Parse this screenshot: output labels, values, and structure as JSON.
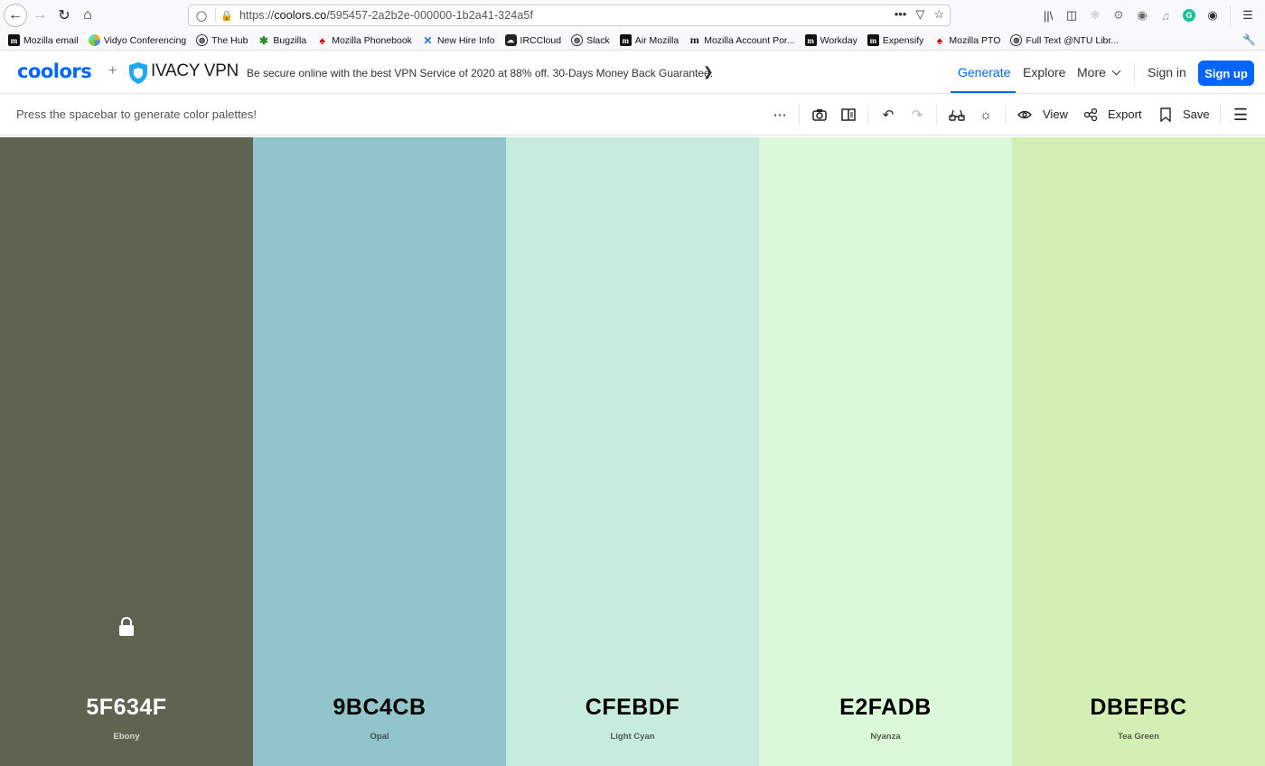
{
  "browser": {
    "url_prefix": "https://",
    "url_domain": "coolors.co",
    "url_path": "/595457-2a2b2e-000000-1b2a41-324a5f",
    "url_actions": [
      "•••",
      "pocket",
      "star"
    ],
    "bookmarks": [
      {
        "label": "Mozilla email",
        "icon": "m",
        "icon_type": "m"
      },
      {
        "label": "Vidyo Conferencing",
        "icon": "",
        "icon_type": "vidyo"
      },
      {
        "label": "The Hub",
        "icon": "◍",
        "icon_type": "globe"
      },
      {
        "label": "Bugzilla",
        "icon": "✱",
        "icon_type": "green"
      },
      {
        "label": "Mozilla Phonebook",
        "icon": "♠",
        "icon_type": "red"
      },
      {
        "label": "New Hire Info",
        "icon": "✕",
        "icon_type": "blue"
      },
      {
        "label": "IRCCloud",
        "icon": "☁",
        "icon_type": "irc"
      },
      {
        "label": "Slack",
        "icon": "◍",
        "icon_type": "globe"
      },
      {
        "label": "Air Mozilla",
        "icon": "m",
        "icon_type": "m"
      },
      {
        "label": "Mozilla Account Por...",
        "icon": "m",
        "icon_type": "mm"
      },
      {
        "label": "Workday",
        "icon": "m",
        "icon_type": "m"
      },
      {
        "label": "Expensify",
        "icon": "m",
        "icon_type": "m"
      },
      {
        "label": "Mozilla PTO",
        "icon": "♠",
        "icon_type": "red"
      },
      {
        "label": "Full Text @NTU Libr...",
        "icon": "◍",
        "icon_type": "globe"
      }
    ]
  },
  "header": {
    "logo": "coolors",
    "plus": "+",
    "partner": "IVACY VPN",
    "promo": "Be secure online with the best VPN Service of 2020 at 88% off. 30-Days Money Back Guarantee.",
    "nav": {
      "generate": "Generate",
      "explore": "Explore",
      "more": "More",
      "sign_in": "Sign in",
      "sign_up": "Sign up"
    },
    "accent": "#0066ff"
  },
  "toolbar": {
    "hint": "Press the spacebar to generate color palettes!",
    "view": "View",
    "export": "Export",
    "save": "Save"
  },
  "palette": [
    {
      "hex": "5F634F",
      "name": "Ebony",
      "color": "#5f634f",
      "text_color": "#ffffff",
      "name_color": "#d6d7cf",
      "locked": true
    },
    {
      "hex": "9BC4CB",
      "name": "Opal",
      "color": "#91c5cb",
      "text_color": "#000000",
      "name_color": "#3b4f52",
      "locked": false
    },
    {
      "hex": "CFEBDF",
      "name": "Light Cyan",
      "color": "#c7ebdd",
      "text_color": "#000000",
      "name_color": "#4d5a55",
      "locked": false
    },
    {
      "hex": "E2FADB",
      "name": "Nyanza",
      "color": "#dbf9d8",
      "text_color": "#000000",
      "name_color": "#545f52",
      "locked": false
    },
    {
      "hex": "DBEFBC",
      "name": "Tea Green",
      "color": "#d3efb4",
      "text_color": "#000000",
      "name_color": "#525c46",
      "locked": false
    }
  ]
}
